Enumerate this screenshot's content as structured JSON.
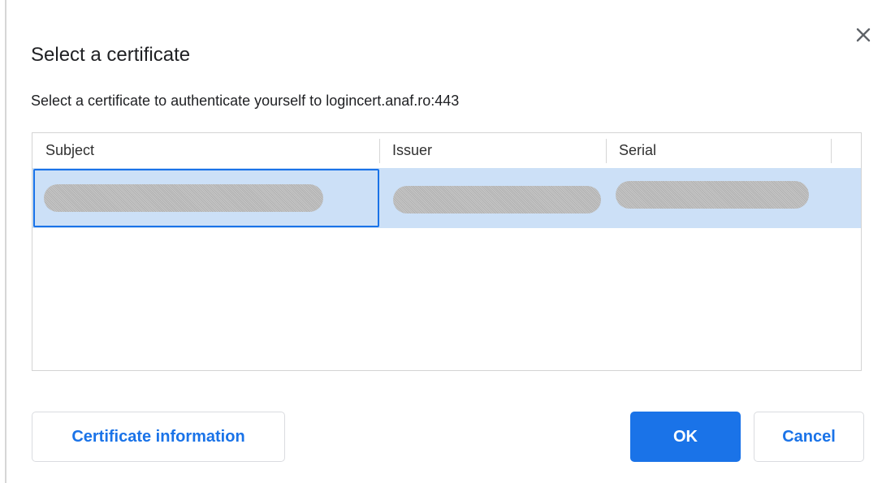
{
  "dialog": {
    "title": "Select a certificate",
    "subtitle": "Select a certificate to authenticate yourself to logincert.anaf.ro:443",
    "close_icon": "close-icon"
  },
  "table": {
    "columns": [
      "Subject",
      "Issuer",
      "Serial"
    ],
    "rows": [
      {
        "subject": "",
        "issuer": "",
        "serial": "",
        "selected": true,
        "redacted": true
      }
    ]
  },
  "buttons": {
    "info_label": "Certificate information",
    "ok_label": "OK",
    "cancel_label": "Cancel"
  },
  "colors": {
    "accent": "#1a73e8",
    "selection": "#cce0f7"
  }
}
